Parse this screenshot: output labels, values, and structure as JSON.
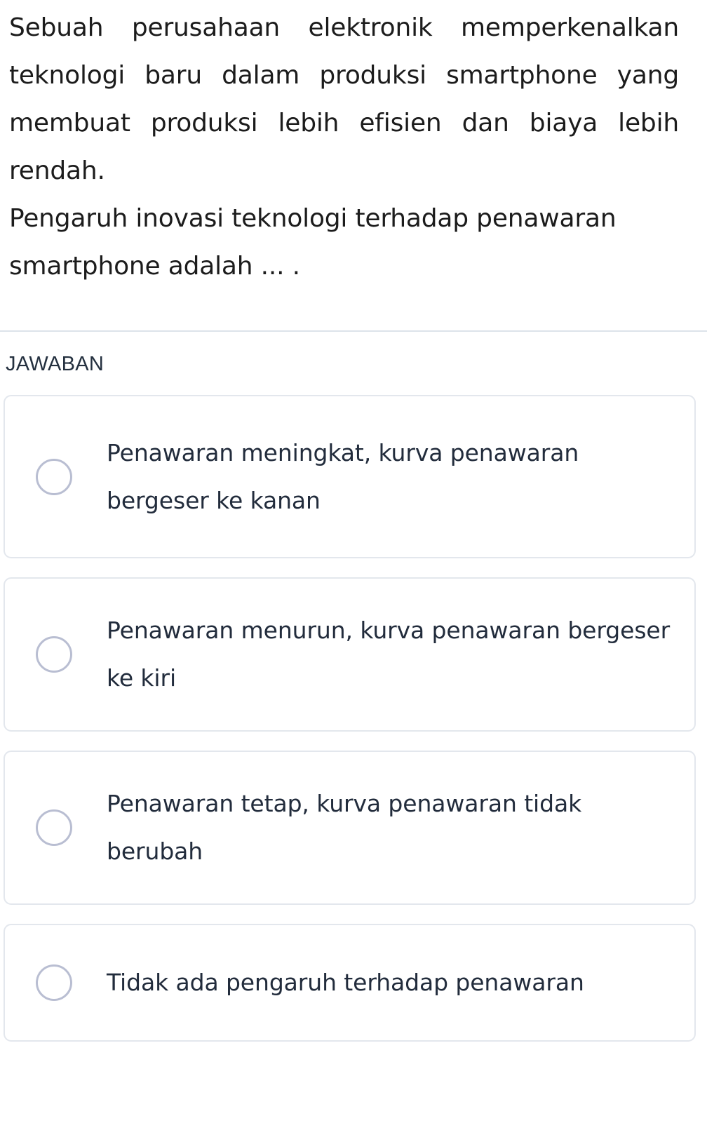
{
  "question": {
    "paragraphs": [
      "Sebuah perusahaan elektronik memperkenalkan teknologi baru dalam produksi smartphone yang membuat produksi lebih efisien dan biaya lebih rendah.",
      "Pengaruh inovasi teknologi terhadap penawaran smartphone adalah ... ."
    ]
  },
  "answer_section": {
    "label": "JAWABAN",
    "options": [
      {
        "text": "Penawaran meningkat, kurva penawaran bergeser ke kanan",
        "selected": false
      },
      {
        "text": "Penawaran menurun, kurva penawaran bergeser ke kiri",
        "selected": false
      },
      {
        "text": "Penawaran tetap, kurva penawaran tidak berubah",
        "selected": false
      },
      {
        "text": "Tidak ada pengaruh terhadap penawaran",
        "selected": false
      }
    ]
  },
  "colors": {
    "text_primary": "#1c1c1c",
    "text_answer": "#222c3c",
    "card_border": "#e3e7ed",
    "radio_border": "#b9bed2",
    "divider": "#dde3ea",
    "background": "#ffffff"
  }
}
